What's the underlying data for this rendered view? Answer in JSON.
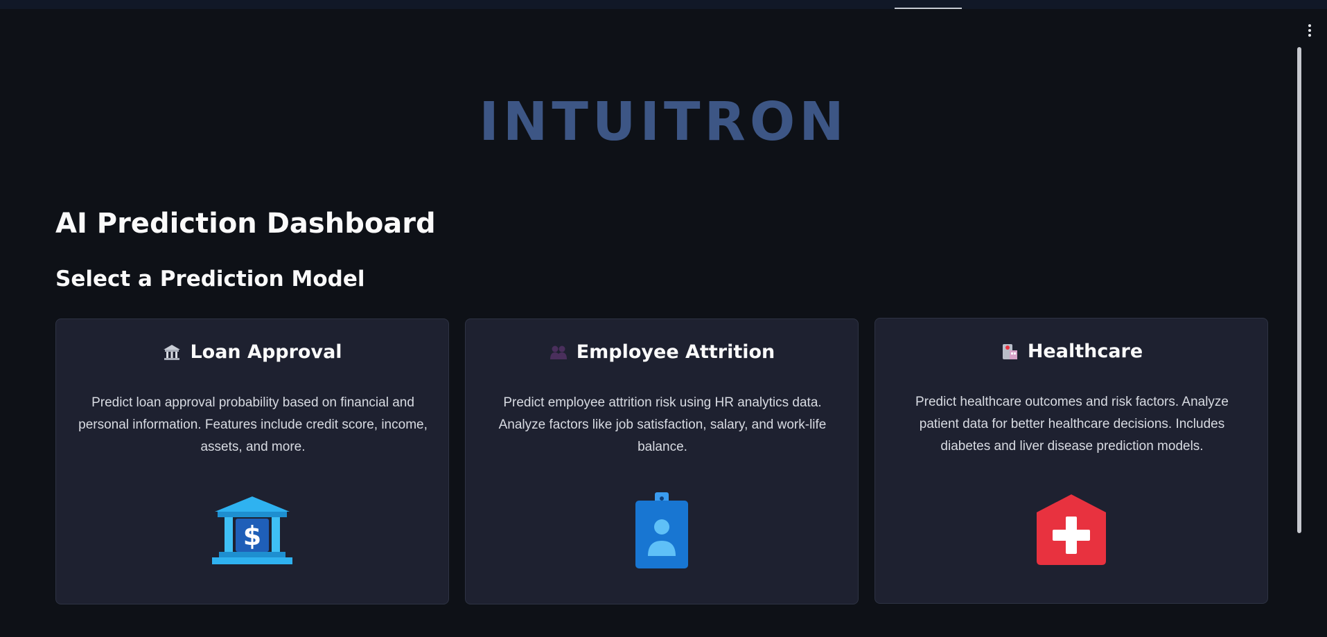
{
  "app": {
    "brand": "INTUITRON"
  },
  "header": {
    "page_title": "AI Prediction Dashboard",
    "section_title": "Select a Prediction Model"
  },
  "cards": [
    {
      "title": "Loan Approval",
      "icon": "bank-icon",
      "description": "Predict loan approval probability based on financial and personal information. Features include credit score, income, assets, and more.",
      "illustration": "bank-dollar-icon"
    },
    {
      "title": "Employee Attrition",
      "icon": "people-icon",
      "description": "Predict employee attrition risk using HR analytics data. Analyze factors like job satisfaction, salary, and work-life balance.",
      "illustration": "id-badge-icon"
    },
    {
      "title": "Healthcare",
      "icon": "hospital-icon",
      "description": "Predict healthcare outcomes and risk factors. Analyze patient data for better healthcare decisions. Includes diabetes and liver disease prediction models.",
      "illustration": "hospital-cross-icon"
    }
  ],
  "colors": {
    "background": "#0e1117",
    "card": "#1e2130",
    "brand": "#3d5685",
    "bank_blue": "#2fb2f0",
    "badge_blue": "#1876d2",
    "hospital_red": "#e8323f"
  }
}
